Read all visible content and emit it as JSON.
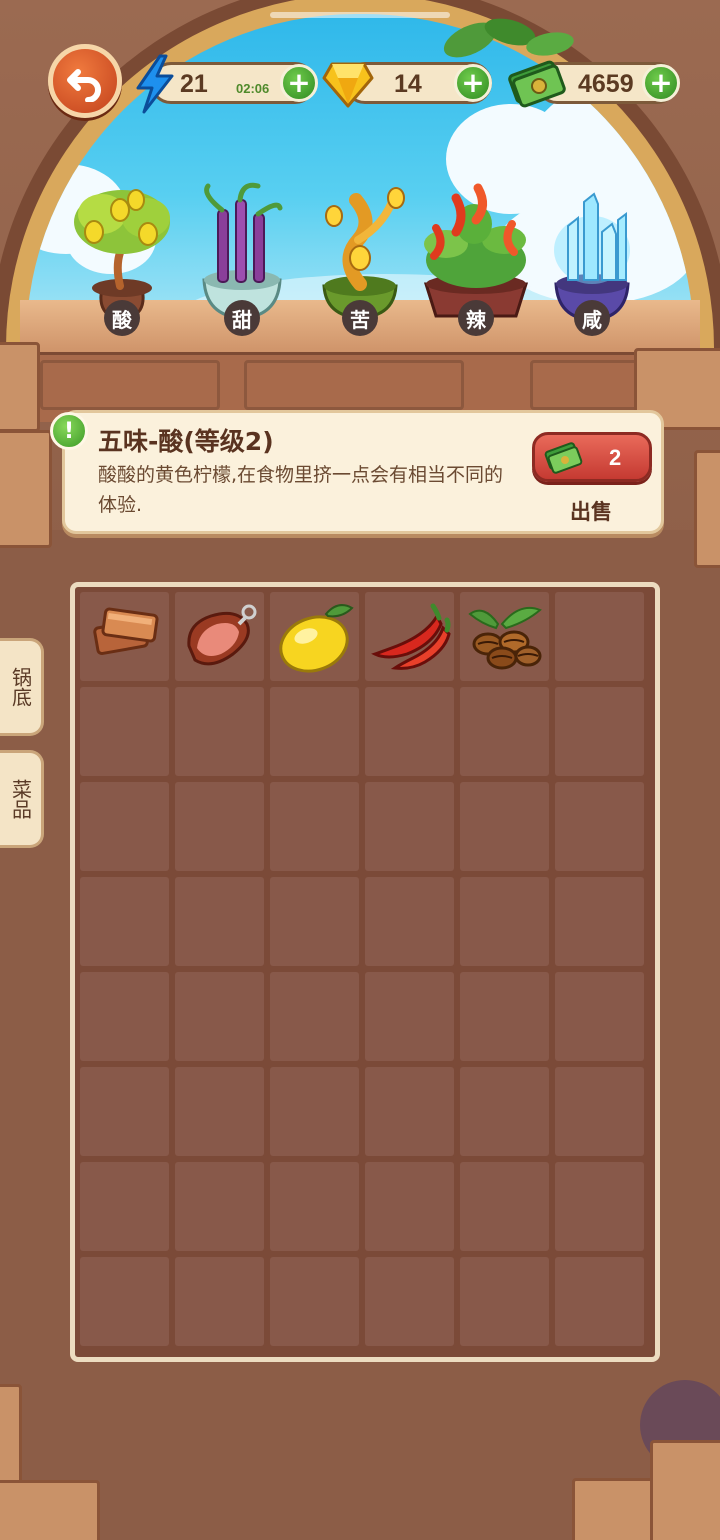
{
  "resources": {
    "energy": {
      "icon": "lightning-icon",
      "value": "21",
      "timer": "02:06"
    },
    "gems": {
      "icon": "gem-icon",
      "value": "14"
    },
    "cash": {
      "icon": "cash-icon",
      "value": "4659"
    }
  },
  "plants": [
    {
      "label": "酸",
      "icon": "lemon-tree-icon"
    },
    {
      "label": "甜",
      "icon": "sugarcane-plant-icon"
    },
    {
      "label": "苦",
      "icon": "golden-bitter-plant-icon"
    },
    {
      "label": "辣",
      "icon": "chili-plant-icon"
    },
    {
      "label": "咸",
      "icon": "salt-crystal-icon"
    }
  ],
  "info": {
    "badge": "!",
    "title": "五味-酸(等级2)",
    "description": "酸酸的黄色柠檬,在食物里挤一点会有相当不同的体验.",
    "sell_price": "2",
    "sell_label": "出售"
  },
  "side_tabs": [
    {
      "label": "锅底"
    },
    {
      "label": "菜品"
    }
  ],
  "inventory": {
    "columns": 6,
    "rows": 8,
    "items": [
      {
        "icon": "tofu-block-icon"
      },
      {
        "icon": "ham-leg-icon"
      },
      {
        "icon": "lemon-icon"
      },
      {
        "icon": "red-chili-icon"
      },
      {
        "icon": "coffee-beans-icon"
      }
    ]
  },
  "colors": {
    "accent_green": "#3c9a27",
    "sell_red": "#c53a32",
    "panel_cream": "#fbf1dc",
    "grid_cell": "#88594a"
  }
}
